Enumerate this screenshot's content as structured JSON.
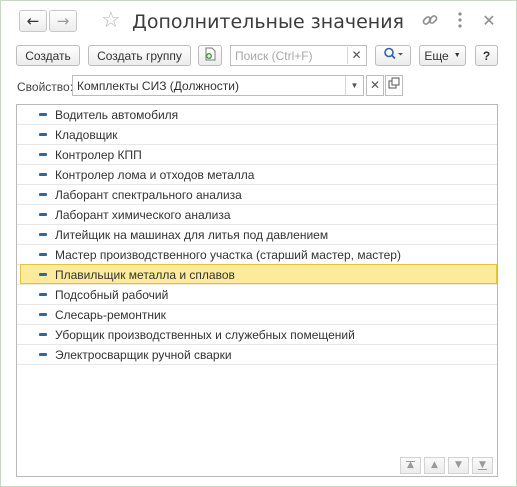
{
  "window": {
    "title": "Дополнительные значения",
    "icons": [
      "arrow-left-icon",
      "arrow-right-icon",
      "star-icon",
      "link-icon",
      "more-vert-icon",
      "close-icon"
    ]
  },
  "toolbar": {
    "create_label": "Создать",
    "create_group_label": "Создать группу",
    "search_placeholder": "Поиск (Ctrl+F)",
    "search_value": "",
    "more_label": "Еще",
    "help_label": "?"
  },
  "property": {
    "label": "Свойство:",
    "value": "Комплекты СИЗ (Должности)"
  },
  "list": {
    "items": [
      "Водитель автомобиля",
      "Кладовщик",
      "Контролер КПП",
      "Контролер лома и отходов металла",
      "Лаборант спектрального анализа",
      "Лаборант химического анализа",
      "Литейщик на машинах для литья под давлением",
      "Мастер производственного участка (старший мастер, мастер)",
      "Плавильщик металла и сплавов",
      "Подсобный рабочий",
      "Слесарь-ремонтник",
      "Уборщик производственных и служебных помещений",
      "Электросварщик ручной сварки"
    ],
    "selected": "Плавильщик металла и сплавов"
  },
  "colors": {
    "accent": "#2f64a8",
    "selection_fill": "#fdeb9c",
    "selection_border": "#e9c23a"
  }
}
